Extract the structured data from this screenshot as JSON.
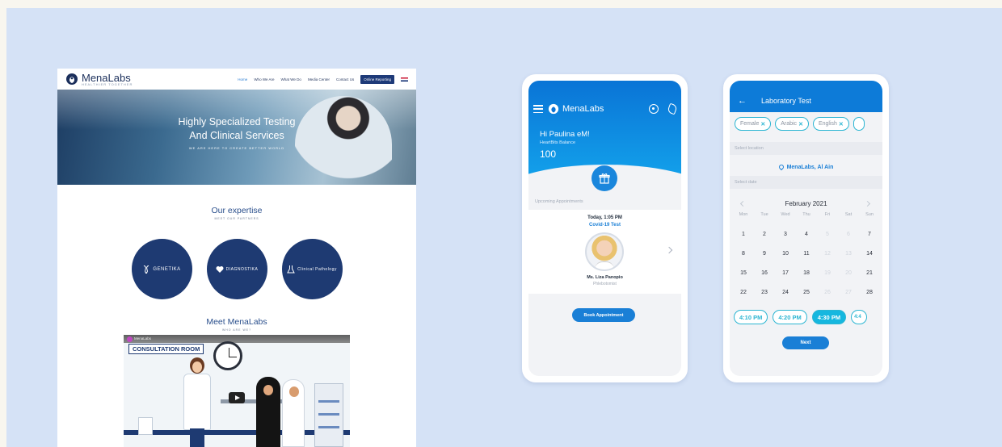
{
  "website": {
    "logo": {
      "name": "MenaLabs",
      "tagline": "HEALTHIER TOGETHER"
    },
    "nav": {
      "items": [
        "Home",
        "Who We Are",
        "What We Do",
        "Media Center",
        "Contact Us"
      ],
      "cta": "Online Reporting"
    },
    "hero": {
      "title_line1": "Highly Specialized Testing",
      "title_line2": "And Clinical Services",
      "subtitle": "WE ARE HERE TO CREATE BETTER WORLD"
    },
    "expertise": {
      "title": "Our expertise",
      "subtitle": "MEET OUR PARTNERS",
      "partners": [
        "GENETIKA",
        "DIAGNOSTIKA",
        "Clinical Pathology"
      ]
    },
    "meet": {
      "title": "Meet MenaLabs",
      "subtitle": "WHO ARE WE?"
    },
    "video": {
      "channel": "MenaLabs",
      "sign": "CONSULTATION ROOM"
    }
  },
  "phone_home": {
    "logo": "MenaLabs",
    "greeting": "Hi Paulina eM!",
    "balance_label": "HeartBits Balance",
    "balance": "100",
    "section_label": "Upcoming Appointments",
    "appointment": {
      "time": "Today, 1:05 PM",
      "test": "Covid-19 Test",
      "name": "Ms. Liza Panopio",
      "role": "Phlebotomist"
    },
    "book_button": "Book Appointment"
  },
  "phone_booking": {
    "title": "Laboratory Test",
    "filters": [
      {
        "label": "Female"
      },
      {
        "label": "Arabic"
      },
      {
        "label": "English"
      }
    ],
    "location_label": "Select location",
    "location": "MenaLabs, Al Ain",
    "date_label": "Select date",
    "month": "February 2021",
    "weekdays": [
      "Mon",
      "Tue",
      "Wed",
      "Thu",
      "Fri",
      "Sat",
      "Sun"
    ],
    "days": [
      {
        "d": "1",
        "dim": false
      },
      {
        "d": "2",
        "dim": false
      },
      {
        "d": "3",
        "dim": false
      },
      {
        "d": "4",
        "dim": false
      },
      {
        "d": "5",
        "dim": true
      },
      {
        "d": "6",
        "dim": true
      },
      {
        "d": "7",
        "dim": false
      },
      {
        "d": "8",
        "dim": false
      },
      {
        "d": "9",
        "dim": false
      },
      {
        "d": "10",
        "dim": false
      },
      {
        "d": "11",
        "dim": false
      },
      {
        "d": "12",
        "dim": true
      },
      {
        "d": "13",
        "dim": true
      },
      {
        "d": "14",
        "dim": false
      },
      {
        "d": "15",
        "dim": false
      },
      {
        "d": "16",
        "dim": false
      },
      {
        "d": "17",
        "dim": false
      },
      {
        "d": "18",
        "dim": false
      },
      {
        "d": "19",
        "dim": true
      },
      {
        "d": "20",
        "dim": true
      },
      {
        "d": "21",
        "dim": false
      },
      {
        "d": "22",
        "dim": false
      },
      {
        "d": "23",
        "dim": false
      },
      {
        "d": "24",
        "dim": false
      },
      {
        "d": "25",
        "dim": false
      },
      {
        "d": "26",
        "dim": true
      },
      {
        "d": "27",
        "dim": true
      },
      {
        "d": "28",
        "dim": false
      }
    ],
    "times": [
      "4:10 PM",
      "4:20 PM",
      "4:30 PM",
      "4:4"
    ],
    "selected_time": "4:30 PM",
    "next_button": "Next"
  },
  "colors": {
    "background": "#d5e2f6",
    "brand_navy": "#1e3a72",
    "app_blue": "#1a7fd6",
    "accent_cyan": "#2bb5d2"
  }
}
